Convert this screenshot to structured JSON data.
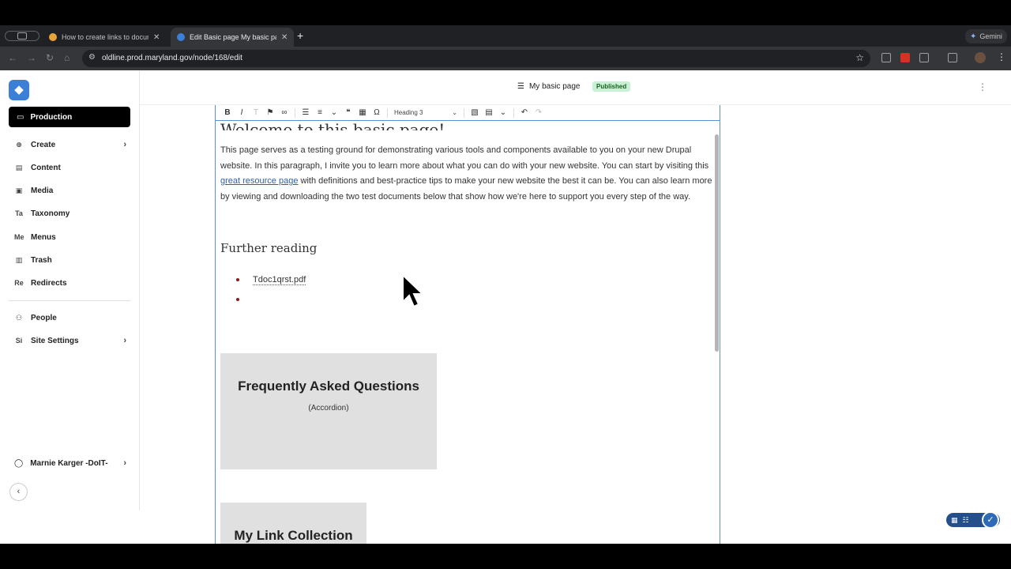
{
  "browser": {
    "tabs": [
      {
        "title": "How to create links to docum",
        "active": false
      },
      {
        "title": "Edit Basic page My basic pag",
        "active": true
      }
    ],
    "new_tab": "+",
    "gemini_label": "Gemini",
    "url": "oldline.prod.maryland.gov/node/168/edit"
  },
  "sidebar": {
    "active_item": "Production",
    "items": [
      {
        "label": "Create",
        "icon": "Ⓐ",
        "has_chevron": true
      },
      {
        "label": "Content",
        "icon": "▤",
        "has_chevron": false
      },
      {
        "label": "Media",
        "icon": "▣",
        "has_chevron": false
      },
      {
        "label": "Taxonomy",
        "icon": "Ta",
        "has_chevron": false
      },
      {
        "label": "Menus",
        "icon": "Me",
        "has_chevron": false
      },
      {
        "label": "Trash",
        "icon": "🗑",
        "has_chevron": false
      },
      {
        "label": "Redirects",
        "icon": "Re",
        "has_chevron": false
      },
      {
        "label": "People",
        "icon": "👥",
        "has_chevron": false
      },
      {
        "label": "Site Settings",
        "icon": "Si",
        "has_chevron": true
      }
    ],
    "user": "Marnie Karger -DoIT-"
  },
  "header": {
    "doc_title": "My basic page",
    "status_badge": "Published"
  },
  "editor": {
    "heading_select": "Heading 3",
    "welcome_heading": "Welcome to this basic page!",
    "para_before_link": "This page serves as a testing ground for demonstrating various tools and components available to you on your new Drupal website. In this paragraph, I invite you to learn more about what you can do with your new website. You can start by visiting this ",
    "link_text": "great resource page",
    "para_after_link": " with definitions and best-practice tips to make your new website the best it can be. You can also learn more by viewing and downloading the two test documents below that show how we're here to support you every step of the way.",
    "further_heading": "Further reading",
    "bullets": [
      "Tdoc1qrst.pdf",
      ""
    ],
    "faq_title": "Frequently Asked Questions",
    "faq_subtitle": "(Accordion)",
    "links_title": "My Link Collection"
  },
  "colors": {
    "accent": "#3b7fd9",
    "badge_bg": "#c8f1d3",
    "editor_border": "#5b8fd6"
  }
}
